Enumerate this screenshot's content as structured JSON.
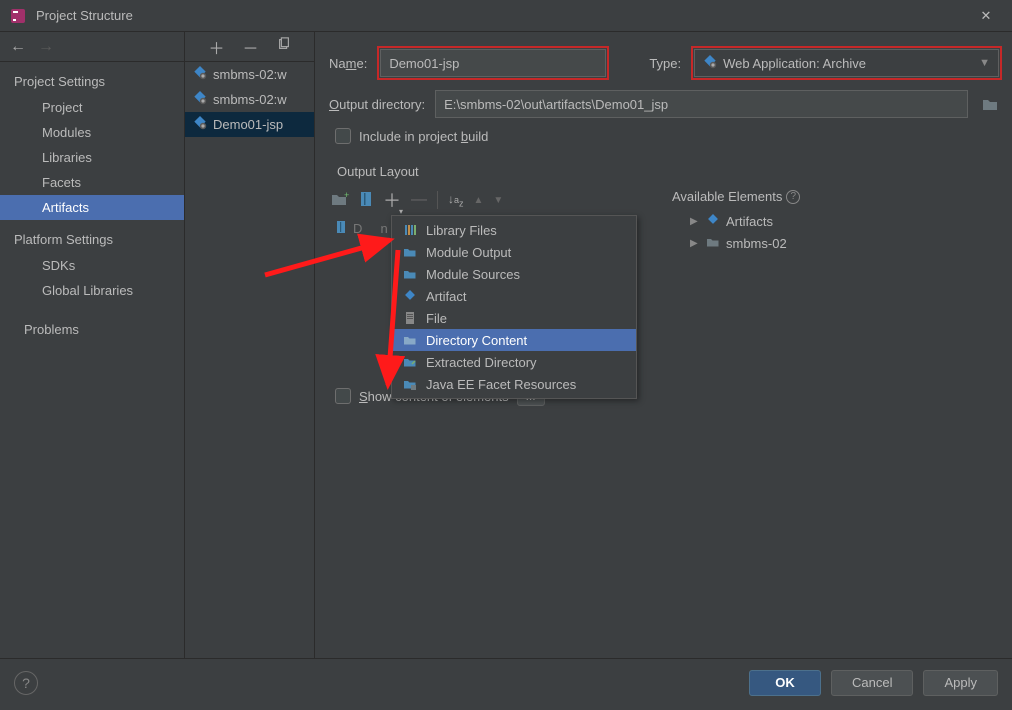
{
  "titlebar": {
    "title": "Project Structure",
    "close_glyph": "✕"
  },
  "nav": {
    "back_glyph": "←",
    "fwd_glyph": "→",
    "section1_title": "Project Settings",
    "items1": [
      "Project",
      "Modules",
      "Libraries",
      "Facets",
      "Artifacts"
    ],
    "section2_title": "Platform Settings",
    "items2": [
      "SDKs",
      "Global Libraries"
    ],
    "problems": "Problems"
  },
  "artifact_list": {
    "add_glyph": "＋",
    "remove_glyph": "－",
    "copy_glyph": "⧉",
    "items": [
      "smbms-02:w",
      "smbms-02:w",
      "Demo01-jsp"
    ]
  },
  "form": {
    "name_label_prefix": "Na",
    "name_label_ul": "m",
    "name_label_suffix": "e:",
    "name_value": "Demo01-jsp",
    "type_label": "Type:",
    "type_value": "Web Application: Archive",
    "outdir_label_prefix": "",
    "outdir_label_ul": "O",
    "outdir_label_suffix": "utput directory:",
    "outdir_value": "E:\\smbms-02\\out\\artifacts\\Demo01_jsp",
    "include_prefix": "Include in project ",
    "include_ul": "b",
    "include_suffix": "uild"
  },
  "layout": {
    "title": "Output Layout",
    "sort_glyph": "↓ᵃz",
    "up_glyph": "▲",
    "down_glyph": "▼",
    "popup_items": [
      "Library Files",
      "Module Output",
      "Module Sources",
      "Artifact",
      "File",
      "Directory Content",
      "Extracted Directory",
      "Java EE Facet Resources"
    ],
    "popup_selected_index": 5
  },
  "available": {
    "title": "Available Elements",
    "items": [
      "Artifacts",
      "smbms-02"
    ]
  },
  "show_content": {
    "prefix": "",
    "ul": "S",
    "suffix": "how content of elements",
    "dots": "..."
  },
  "buttons": {
    "ok": "OK",
    "cancel": "Cancel",
    "apply": "Apply",
    "help": "?"
  }
}
